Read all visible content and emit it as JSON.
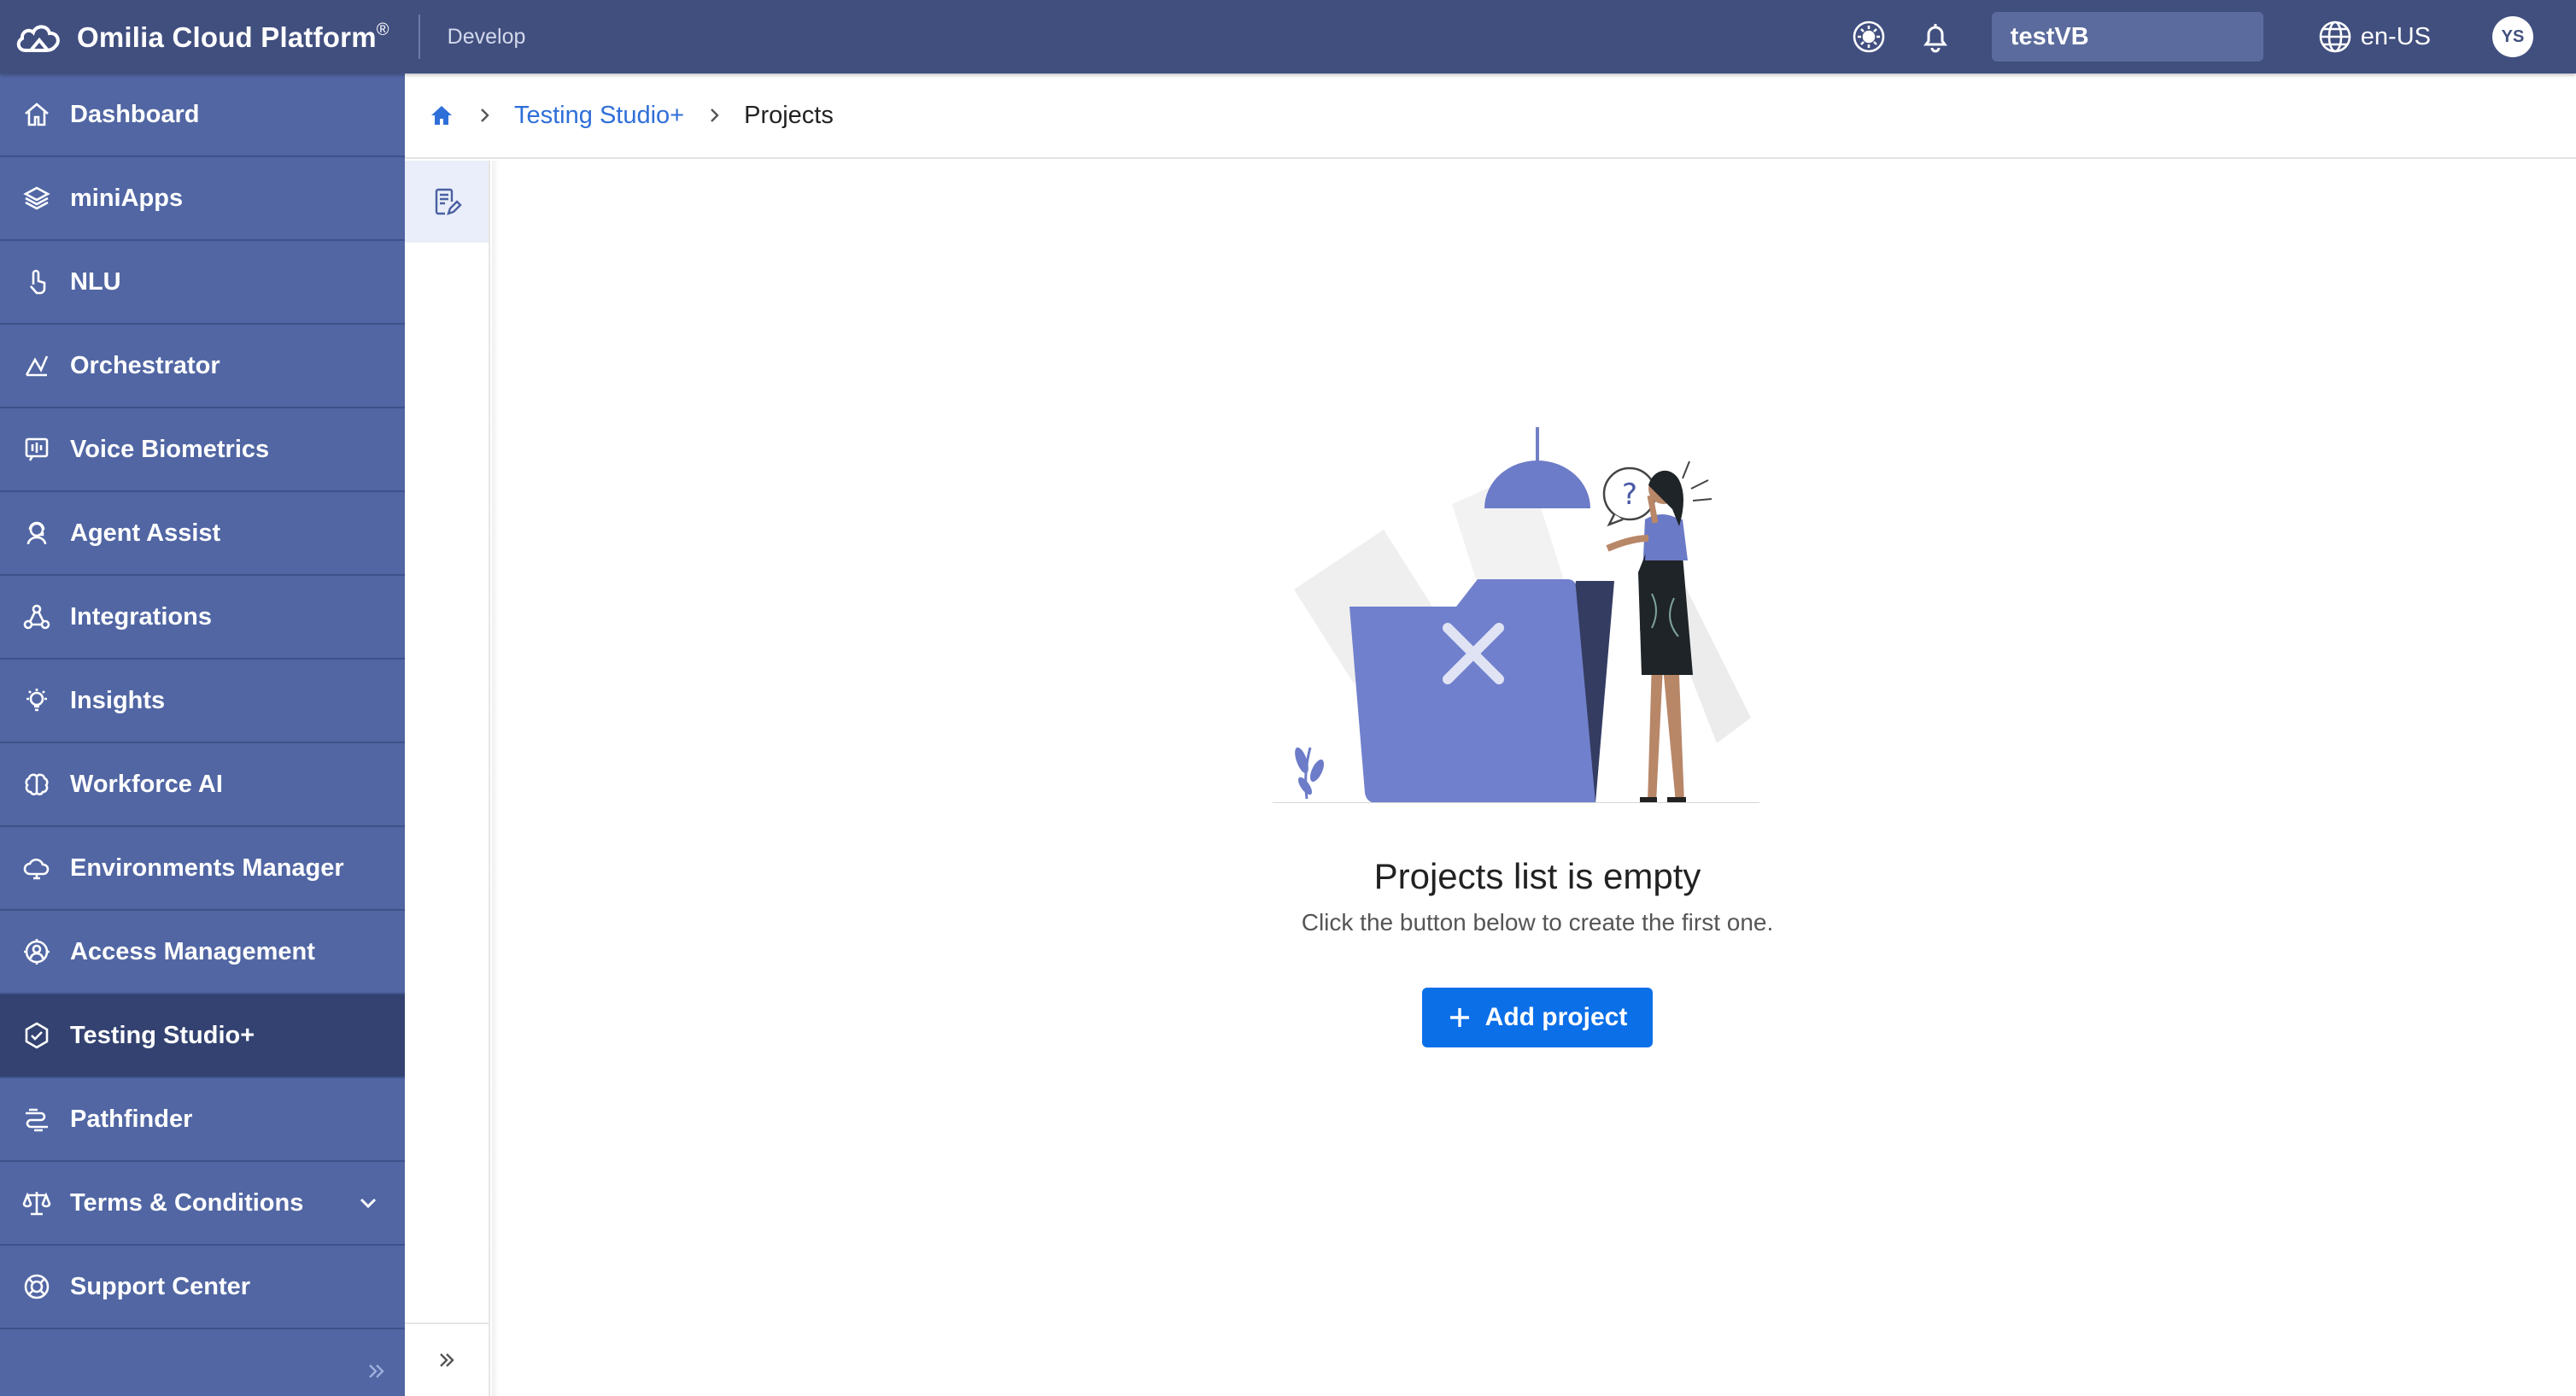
{
  "topbar": {
    "brand": "Omilia Cloud Platform",
    "brand_mark": "®",
    "environment": "Develop",
    "tenant": "testVB",
    "language": "en-US",
    "avatar_initials": "YS"
  },
  "sidebar": {
    "items": [
      {
        "label": "Dashboard",
        "icon": "home-icon"
      },
      {
        "label": "miniApps",
        "icon": "layers-icon"
      },
      {
        "label": "NLU",
        "icon": "tap-icon"
      },
      {
        "label": "Orchestrator",
        "icon": "orchestrator-icon"
      },
      {
        "label": "Voice Biometrics",
        "icon": "voiceprint-icon"
      },
      {
        "label": "Agent Assist",
        "icon": "agent-icon"
      },
      {
        "label": "Integrations",
        "icon": "integrations-icon"
      },
      {
        "label": "Insights",
        "icon": "lightbulb-icon"
      },
      {
        "label": "Workforce AI",
        "icon": "brain-icon"
      },
      {
        "label": "Environments Manager",
        "icon": "cloud-icon"
      },
      {
        "label": "Access Management",
        "icon": "gear-user-icon"
      },
      {
        "label": "Testing Studio+",
        "icon": "hexagon-check-icon",
        "active": true
      },
      {
        "label": "Pathfinder",
        "icon": "path-icon"
      },
      {
        "label": "Terms & Conditions",
        "icon": "scale-icon",
        "expandable": true
      },
      {
        "label": "Support Center",
        "icon": "lifebuoy-icon"
      }
    ]
  },
  "breadcrumb": {
    "parent": "Testing Studio+",
    "current": "Projects"
  },
  "empty_state": {
    "title": "Projects list is empty",
    "subtitle": "Click the button below to create the first one.",
    "button": "Add project"
  },
  "colors": {
    "topbar": "#414f7f",
    "sidebar": "#5166a3",
    "sidebar_active": "#334270",
    "accent": "#0b6fe8",
    "link": "#2f6fd8"
  }
}
